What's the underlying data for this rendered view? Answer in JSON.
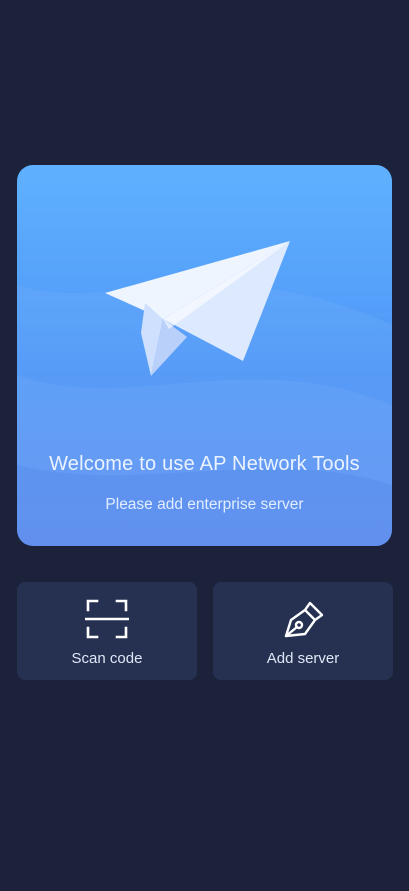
{
  "hero": {
    "title": "Welcome to use AP Network Tools",
    "subtitle": "Please add enterprise server",
    "illustration_icon": "paper-plane-icon"
  },
  "actions": [
    {
      "label": "Scan code",
      "icon": "scan-code-icon"
    },
    {
      "label": "Add server",
      "icon": "pen-nib-icon"
    }
  ],
  "colors": {
    "background": "#1b223a",
    "card_top": "#5fb1ff",
    "card_bottom": "#5a8df2",
    "button_bg": "#263152",
    "text_light": "#dfe6f5"
  }
}
